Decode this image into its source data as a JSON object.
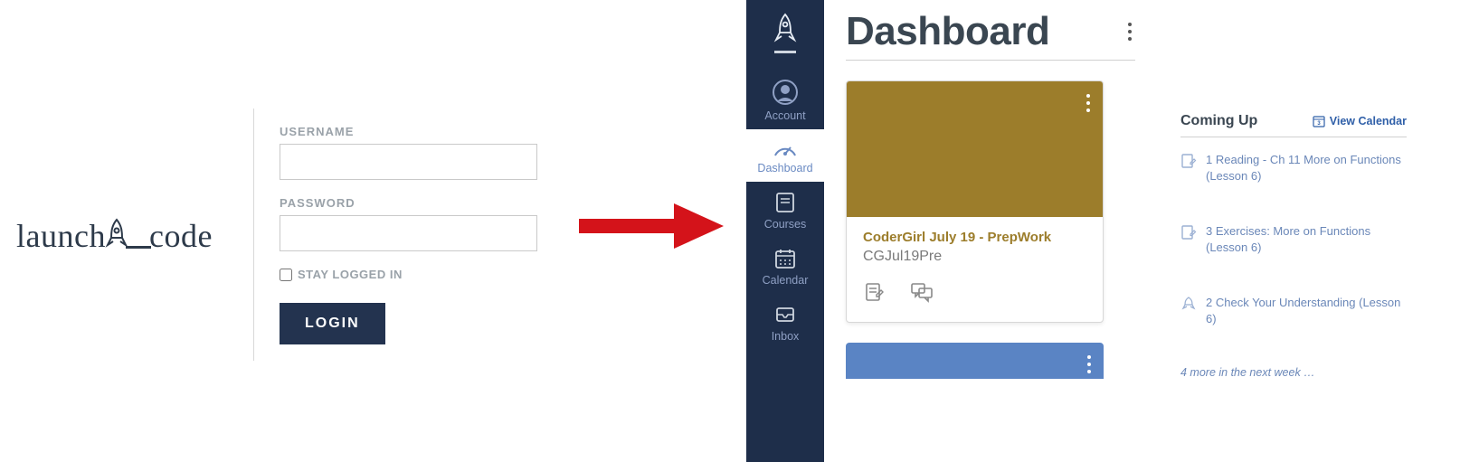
{
  "logo": {
    "part1": "launch",
    "part2": "code"
  },
  "login": {
    "username_label": "USERNAME",
    "password_label": "PASSWORD",
    "stay_label": "STAY LOGGED IN",
    "button_label": "LOGIN"
  },
  "sidebar": {
    "items": [
      {
        "label": "Account"
      },
      {
        "label": "Dashboard"
      },
      {
        "label": "Courses"
      },
      {
        "label": "Calendar"
      },
      {
        "label": "Inbox"
      }
    ]
  },
  "dashboard": {
    "title": "Dashboard",
    "card": {
      "title": "CoderGirl July 19 - PrepWork",
      "subtitle": "CGJul19Pre",
      "hero_color": "#9c7d2b"
    }
  },
  "coming_up": {
    "title": "Coming Up",
    "view_calendar_label": "View Calendar",
    "items": [
      {
        "text": "1 Reading - Ch 11 More on Functions (Lesson 6)"
      },
      {
        "text": "3 Exercises: More on Functions (Lesson 6)"
      },
      {
        "text": "2 Check Your Understanding (Lesson 6)"
      }
    ],
    "more_text": "4 more in the next week …"
  }
}
